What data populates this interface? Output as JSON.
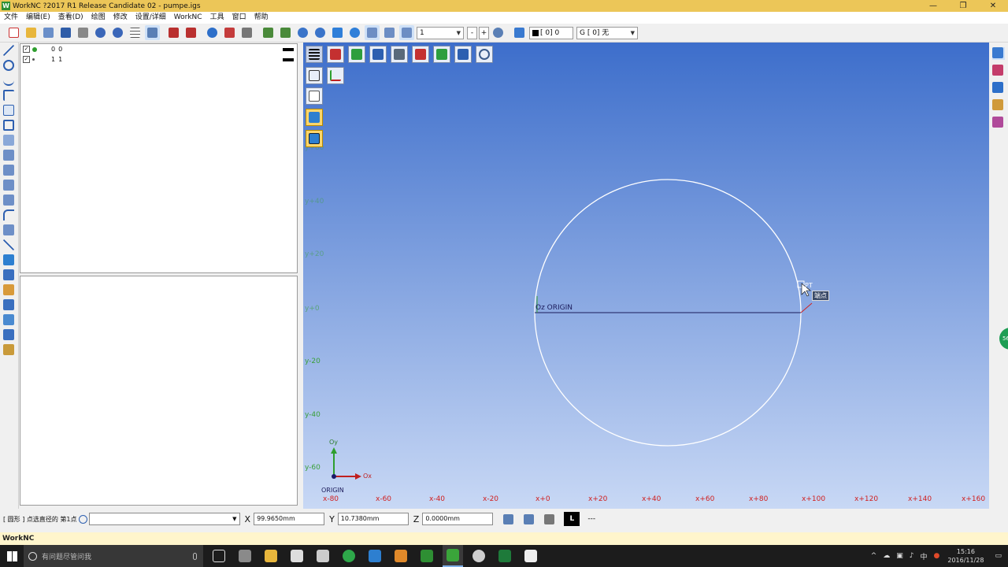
{
  "window": {
    "app_icon": "W",
    "title": "WorkNC ?2017 R1 Release Candidate 02 - pumpe.igs",
    "minimize": "—",
    "maximize": "❐",
    "close": "✕"
  },
  "menu": [
    "文件",
    "编辑(E)",
    "查看(D)",
    "绘图",
    "修改",
    "设置/详细",
    "WorkNC",
    "工具",
    "窗口",
    "帮助"
  ],
  "toolbar": {
    "layer_combo": "1",
    "minus_label": "-",
    "plus_label": "+",
    "color_combo": "[  0] 0",
    "group_combo": "G [  0] 无"
  },
  "layers": [
    {
      "number": "0",
      "value": "0",
      "checked": "✓",
      "color": "#2e9e2e"
    },
    {
      "number": "1",
      "value": "1",
      "checked": "✓",
      "color": "#555555"
    }
  ],
  "viewport": {
    "origin_label": "Oz ORIGIN",
    "point_label": "PT",
    "tooltip": "端点",
    "axis_y": "Oy",
    "axis_x": "Ox",
    "origin_caption": "ORIGIN",
    "y_ticks": [
      "y+60",
      "y+40",
      "y+20",
      "y+0",
      "y-20",
      "y-40",
      "y-60"
    ],
    "x_ticks": [
      "x-80",
      "x-60",
      "x-40",
      "x-20",
      "x+0",
      "x+20",
      "x+40",
      "x+60",
      "x+80",
      "x+100",
      "x+120",
      "x+140",
      "x+160"
    ]
  },
  "status": {
    "prompt": "[ 圆形 ] 点选直径的 第1点",
    "x_label": "X",
    "x_value": "99.9650mm",
    "y_label": "Y",
    "y_value": "10.7380mm",
    "z_label": "Z",
    "z_value": "0.0000mm",
    "l_button": "L",
    "dash": "---"
  },
  "app_status": "WorkNC",
  "taskbar": {
    "search_placeholder": "有问题尽管问我",
    "time": "15:16",
    "date": "2016/11/28",
    "ime": "中",
    "badge": "56"
  }
}
